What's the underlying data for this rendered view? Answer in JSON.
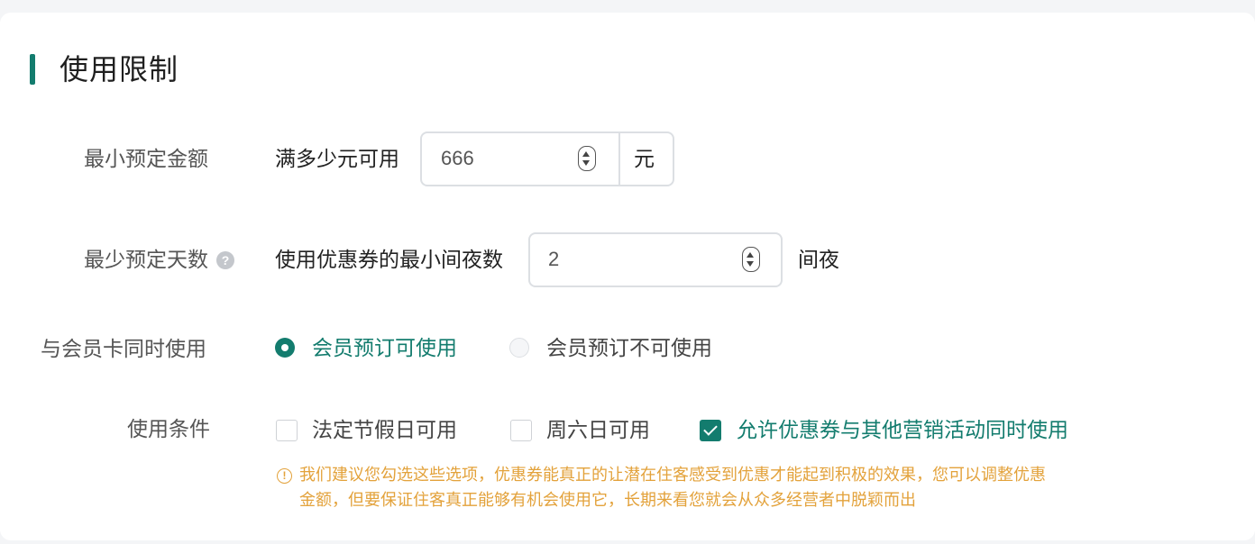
{
  "section": {
    "title": "使用限制"
  },
  "min_amount": {
    "label": "最小预定金额",
    "prefix": "满多少元可用",
    "value": "666",
    "unit": "元"
  },
  "min_nights": {
    "label": "最少预定天数",
    "prefix": "使用优惠券的最小间夜数",
    "value": "2",
    "unit": "间夜"
  },
  "member_card": {
    "label": "与会员卡同时使用",
    "options": [
      {
        "label": "会员预订可使用",
        "selected": true
      },
      {
        "label": "会员预订不可使用",
        "selected": false
      }
    ]
  },
  "conditions": {
    "label": "使用条件",
    "options": [
      {
        "label": "法定节假日可用",
        "checked": false
      },
      {
        "label": "周六日可用",
        "checked": false
      },
      {
        "label": "允许优惠券与其他营销活动同时使用",
        "checked": true
      }
    ]
  },
  "tip": {
    "line1": "我们建议您勾选这些选项，优惠券能真正的让潜在住客感受到优惠才能起到积极的效果，您可以调整优惠",
    "line2": "金额，但要保证住客真正能够有机会使用它，长期来看您就会从众多经营者中脱颖而出"
  },
  "colors": {
    "accent": "#137c6e",
    "warning": "#e3a23b"
  }
}
